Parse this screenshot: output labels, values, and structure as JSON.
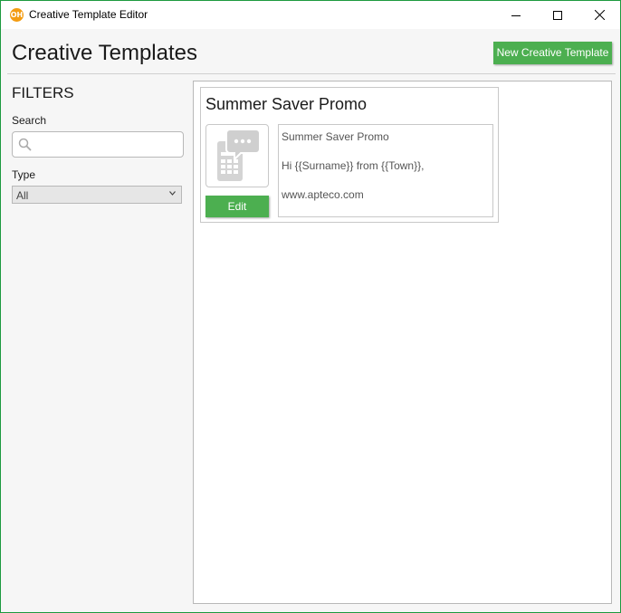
{
  "window": {
    "title": "Creative Template Editor",
    "icon": "apteco-logo-icon",
    "icon_text": "OH",
    "controls": [
      "minimize-icon",
      "maximize-icon",
      "close-icon"
    ]
  },
  "header": {
    "title": "Creative Templates",
    "new_button_label": "New Creative Template"
  },
  "filters": {
    "heading": "FILTERS",
    "search": {
      "label": "Search",
      "placeholder": "",
      "value": "",
      "icon": "search-icon"
    },
    "type": {
      "label": "Type",
      "selected": "All",
      "icon": "chevron-down-icon"
    }
  },
  "templates": [
    {
      "title": "Summer Saver Promo",
      "thumbnail_icon": "sms-phone-icon",
      "edit_label": "Edit",
      "preview_lines": [
        "Summer Saver Promo",
        "Hi {{Surname}} from {{Town}},",
        "www.apteco.com"
      ]
    }
  ],
  "colors": {
    "accent_green": "#4caf50",
    "window_border": "#1d9a3f",
    "app_icon": "#f39c12"
  }
}
